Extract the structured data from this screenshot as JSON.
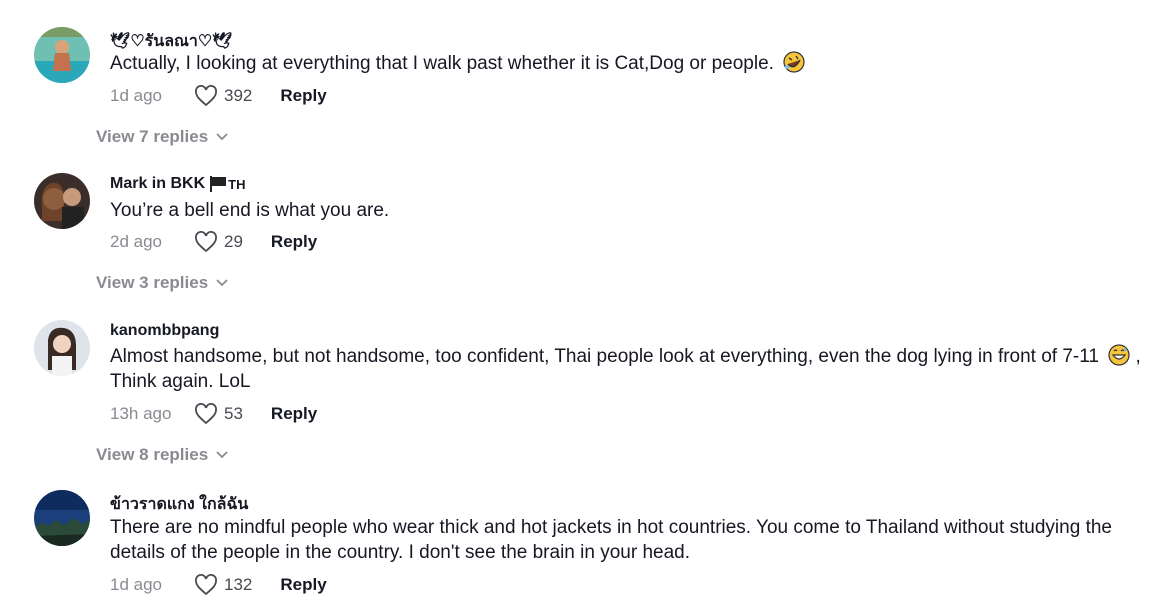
{
  "comments": [
    {
      "username": "🕊♡รันลณา♡🕊",
      "text": "Actually, I looking at everything that I walk past whether it is Cat,Dog or people.",
      "time": "1d ago",
      "likes": "392",
      "reply_label": "Reply",
      "view_replies": "View 7 replies",
      "emoji": "rolling-on-floor-laughing-emoji"
    },
    {
      "username": "Mark in BKK",
      "flag_label": "TH",
      "text": "You’re a bell end is what you are.",
      "time": "2d ago",
      "likes": "29",
      "reply_label": "Reply",
      "view_replies": "View 3 replies"
    },
    {
      "username": "kanombbpang",
      "text_part1": "Almost handsome, but not handsome, too confident, Thai people look at everything, even the dog lying in front of 7-11",
      "text_part2": ", Think again. LoL",
      "time": "13h ago",
      "likes": "53",
      "reply_label": "Reply",
      "view_replies": "View 8 replies",
      "emoji": "grinning-sweat-emoji"
    },
    {
      "username": "ข้าวราดแกง ใกล้ฉัน",
      "text": "There are no mindful people who wear thick and hot jackets in hot countries. You come to Thailand without studying the details of the people in the country. I don't see the brain in your head.",
      "time": "1d ago",
      "likes": "132",
      "reply_label": "Reply"
    }
  ],
  "colors": {
    "text": "#161823",
    "muted": "#8a8b91",
    "background": "#ffffff"
  }
}
